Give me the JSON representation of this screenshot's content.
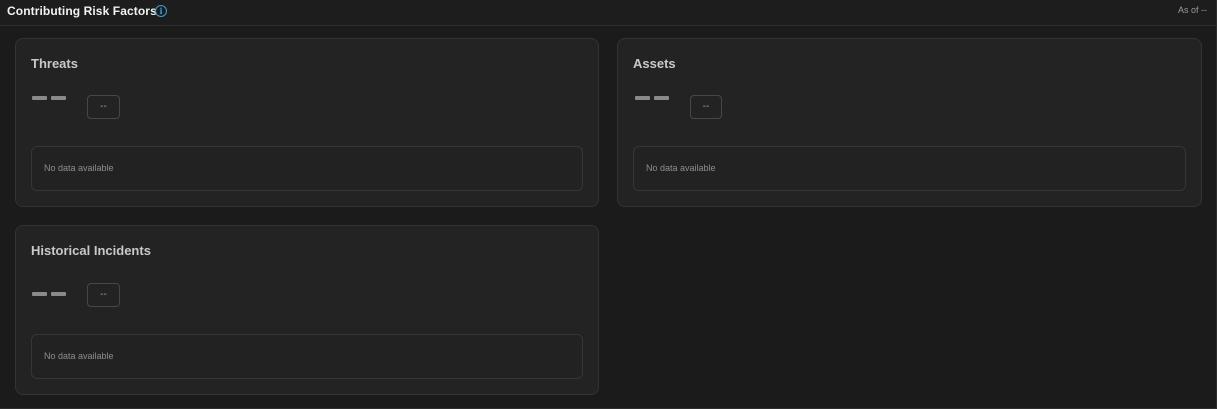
{
  "header": {
    "title": "Contributing Risk Factors",
    "info_icon": "info-icon",
    "as_of": "As of --"
  },
  "cards": {
    "threats": {
      "title": "Threats",
      "delta": "--",
      "empty": "No data available"
    },
    "assets": {
      "title": "Assets",
      "delta": "--",
      "empty": "No data available"
    },
    "historical": {
      "title": "Historical Incidents",
      "delta": "--",
      "empty": "No data available"
    }
  },
  "colors": {
    "background": "#1b1b1b",
    "card": "#232323",
    "accent": "#3aa0d8"
  }
}
